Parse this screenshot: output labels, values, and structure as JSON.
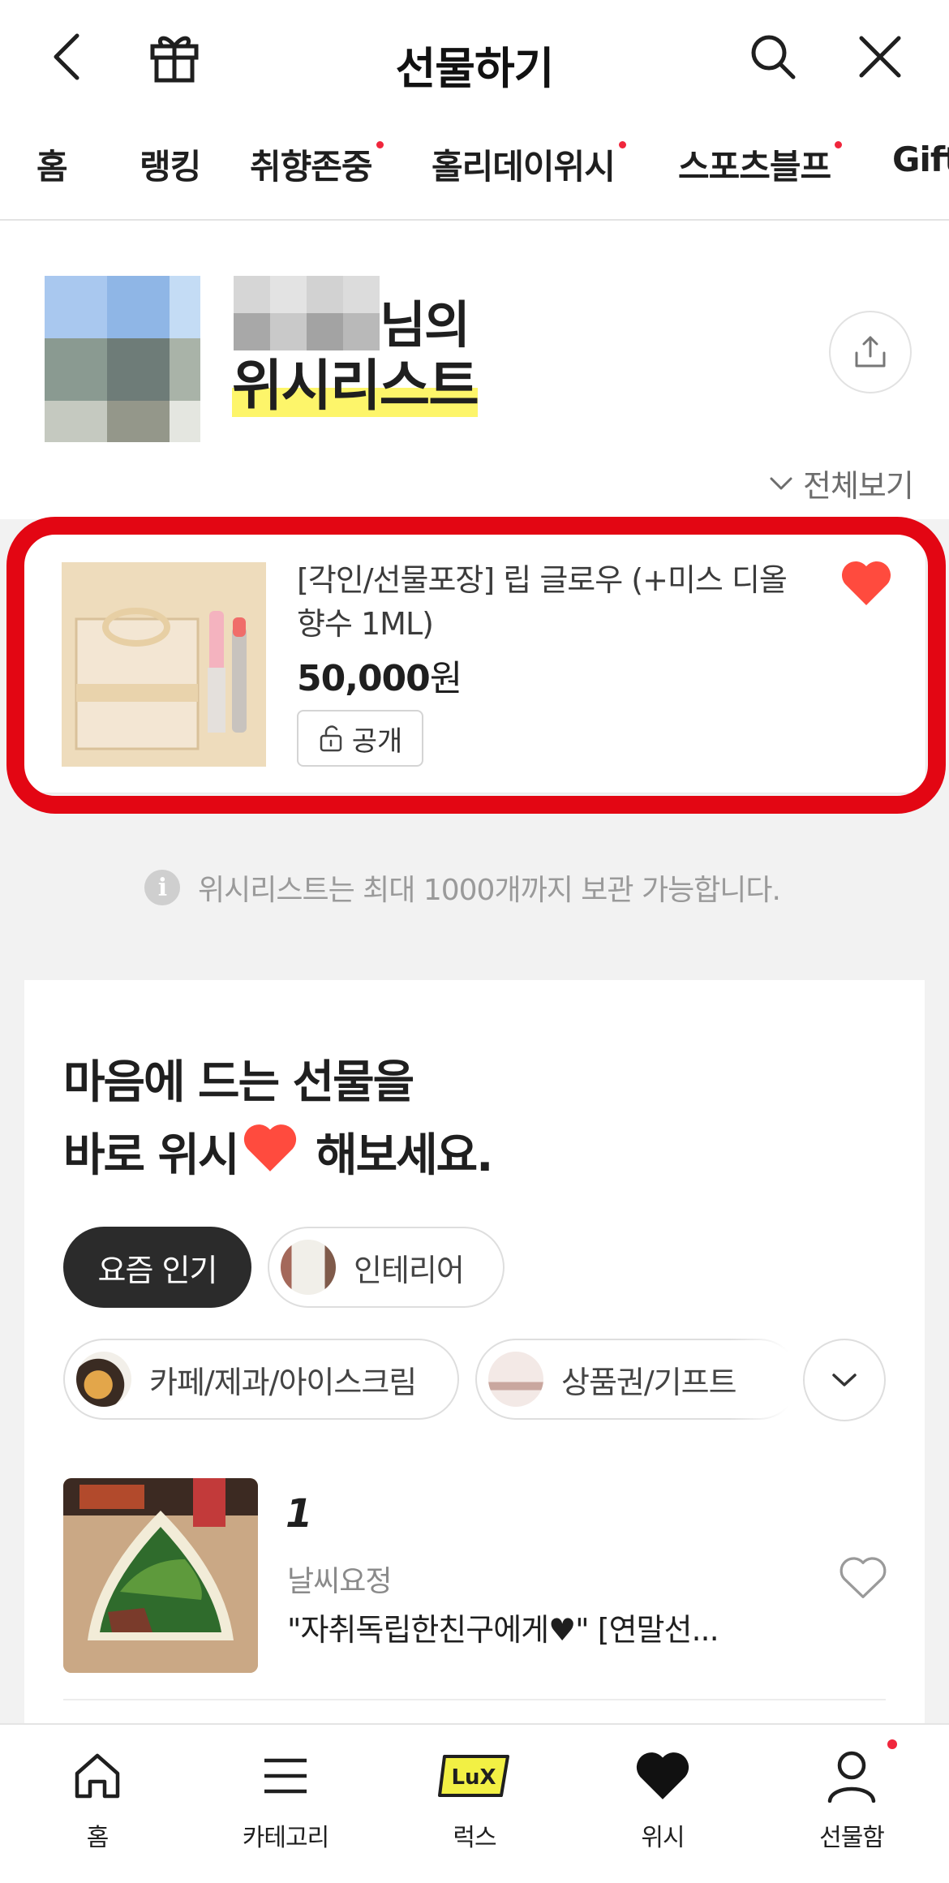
{
  "header": {
    "title": "선물하기",
    "icons": [
      "back-arrow-icon",
      "gift-icon",
      "search-icon",
      "close-icon"
    ]
  },
  "tabs": [
    {
      "label": "홈",
      "new": false
    },
    {
      "label": "랭킹",
      "new": false
    },
    {
      "label": "취향존중",
      "new": true
    },
    {
      "label": "홀리데이위시",
      "new": true
    },
    {
      "label": "스포츠블프",
      "new": true
    },
    {
      "label": "Gift",
      "new": false
    }
  ],
  "profile": {
    "nickname_suffix": "님의",
    "wishlist_title": "위시리스트",
    "view_all": "전체보기"
  },
  "wish_item": {
    "name": "[각인/선물포장] 립 글로우 (+미스 디올 향수 1ML)",
    "price_number": "50,000",
    "price_unit": "원",
    "visibility": "공개",
    "liked": true
  },
  "info_text": "위시리스트는 최대 1000개까지 보관 가능합니다.",
  "recommend": {
    "title_line1": "마음에 드는 선물을",
    "title_line2_a": "바로 위시",
    "title_line2_b": " 해보세요.",
    "chips": [
      {
        "label": "요즘 인기",
        "active": true
      },
      {
        "label": "인테리어",
        "active": false
      },
      {
        "label": "카페/제과/아이스크림",
        "active": false
      },
      {
        "label": "상품권/기프트",
        "active": false
      }
    ],
    "top_item": {
      "rank": "1",
      "brand": "날씨요정",
      "name": "\"자취독립한친구에게♥\" [연말선..."
    }
  },
  "bottom_nav": [
    {
      "label": "홈",
      "icon": "home-icon"
    },
    {
      "label": "카테고리",
      "icon": "menu-icon"
    },
    {
      "label": "럭스",
      "icon": "lux-icon"
    },
    {
      "label": "위시",
      "icon": "heart-icon"
    },
    {
      "label": "선물함",
      "icon": "person-icon"
    }
  ],
  "colors": {
    "accent_red": "#e30613",
    "heart_red": "#ff4b3e",
    "highlight_yellow": "#fdf56a",
    "notification_dot": "#f0263c"
  }
}
